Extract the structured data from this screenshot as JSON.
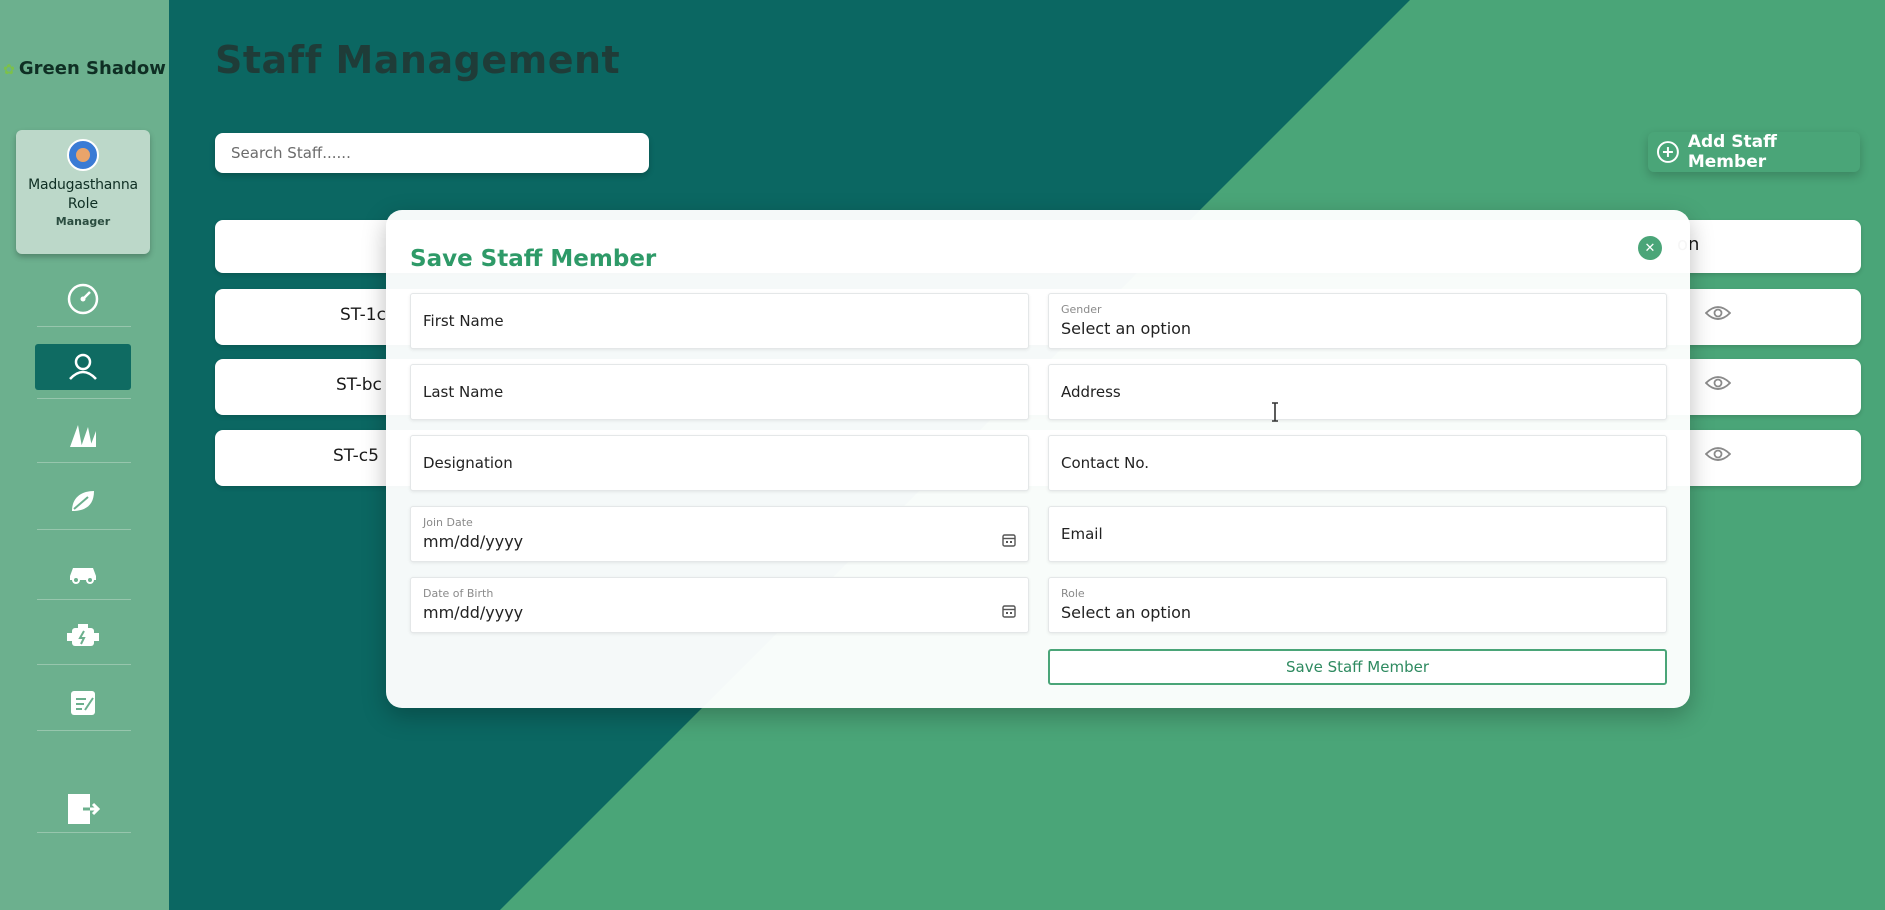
{
  "app": {
    "brand": "Green Shadow"
  },
  "user": {
    "name": "Madugasthanna",
    "role_label": "Role",
    "role_value": "Manager"
  },
  "nav": [
    {
      "icon": "dashboard-gauge-icon"
    },
    {
      "icon": "staff-users-icon",
      "active": true
    },
    {
      "icon": "field-icon"
    },
    {
      "icon": "crop-leaf-icon"
    },
    {
      "icon": "vehicle-car-icon"
    },
    {
      "icon": "equipment-engine-icon"
    },
    {
      "icon": "logs-note-icon"
    },
    {
      "icon": "logout-icon"
    }
  ],
  "main": {
    "title": "Staff Management",
    "search_placeholder": "Search Staff......",
    "add_button_label": "Add Staff Member"
  },
  "table": {
    "header_tail": "on",
    "rows": [
      {
        "id": "ST-1c"
      },
      {
        "id": "ST-bc"
      },
      {
        "id": "ST-c5"
      }
    ]
  },
  "modal": {
    "title": "Save Staff Member",
    "fields": {
      "first_name": "First Name",
      "last_name": "Last Name",
      "designation": "Designation",
      "join_date_label": "Join Date",
      "join_date_value": "mm/dd/yyyy",
      "dob_label": "Date of Birth",
      "dob_value": "mm/dd/yyyy",
      "gender_label": "Gender",
      "gender_value": "Select an option",
      "address": "Address",
      "contact": "Contact No.",
      "email": "Email",
      "role_label": "Role",
      "role_value": "Select an option"
    },
    "submit_label": "Save Staff Member"
  },
  "colors": {
    "sidebar": "#6cb08e",
    "dark_teal": "#0b6762",
    "accent_green": "#4aa578",
    "title_green": "#2e9a68"
  }
}
